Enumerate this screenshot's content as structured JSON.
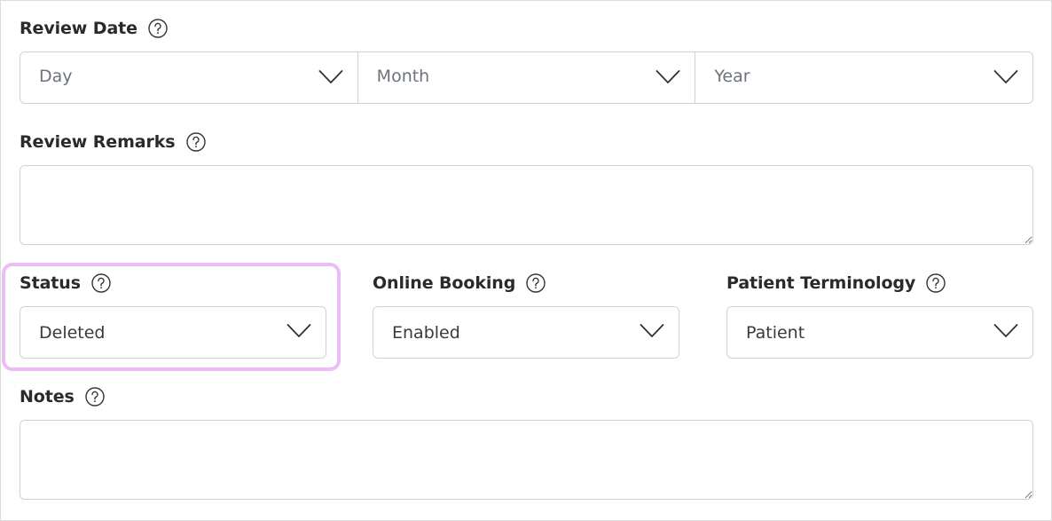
{
  "review_date": {
    "label": "Review Date",
    "day_placeholder": "Day",
    "month_placeholder": "Month",
    "year_placeholder": "Year"
  },
  "review_remarks": {
    "label": "Review Remarks",
    "value": ""
  },
  "status": {
    "label": "Status",
    "value": "Deleted"
  },
  "online_booking": {
    "label": "Online Booking",
    "value": "Enabled"
  },
  "patient_terminology": {
    "label": "Patient Terminology",
    "value": "Patient"
  },
  "notes": {
    "label": "Notes",
    "value": ""
  },
  "colors": {
    "highlight": "#ebbdf5",
    "border": "#cfd3d8",
    "label_text": "#2a2a2a",
    "placeholder_text": "#6d737b"
  },
  "icons": [
    "help-circle-icon",
    "chevron-down-icon",
    "resize-handle-icon"
  ]
}
